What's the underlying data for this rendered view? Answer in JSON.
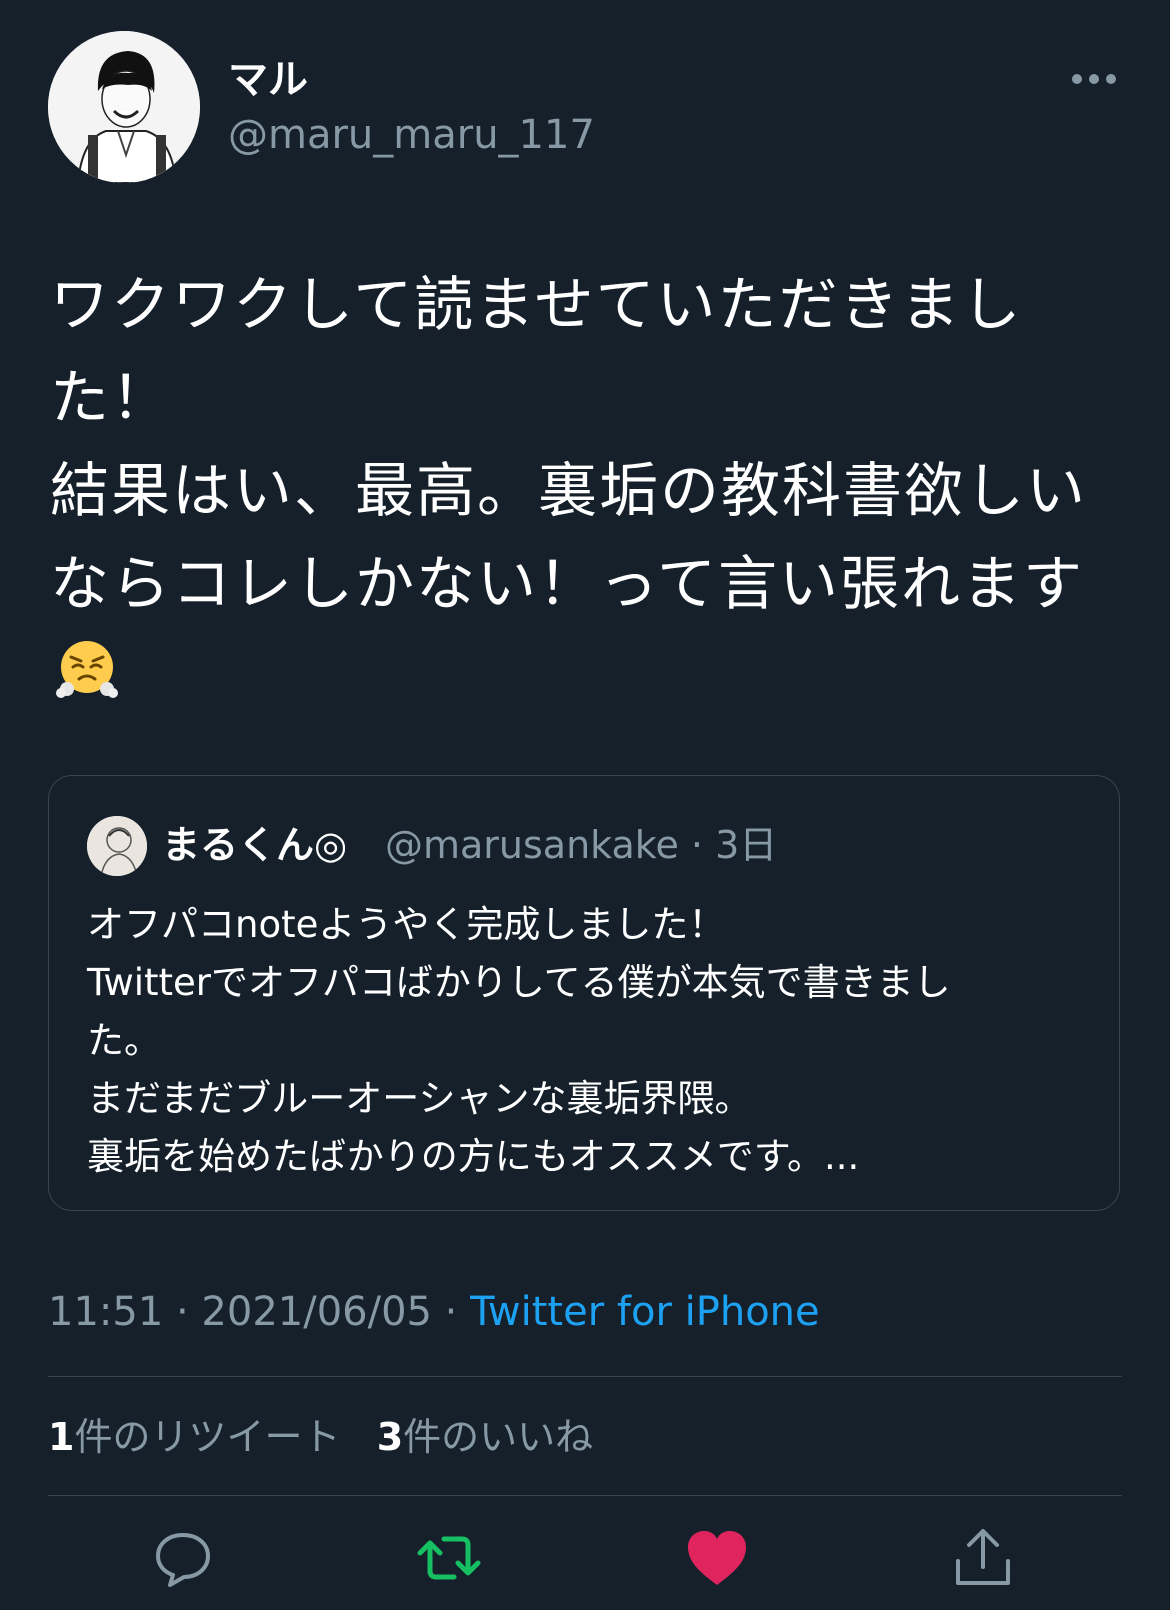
{
  "tweet": {
    "display_name": "マル",
    "handle": "@maru_maru_117",
    "text": "ワクワクして読ませていただきまし\nた！\n結果はい、最高。裏垢の教科書欲しい\nならコレしかない！って言い張れます",
    "emoji": "face-with-steam-from-nose"
  },
  "quote": {
    "display_name": "まるくん◎",
    "handle_time": "@marusankake · 3日",
    "text": "オフパコnoteようやく完成しました！\nTwitterでオフパコばかりしてる僕が本気で書きまし\nた。\nまだまだブルーオーシャンな裏垢界隈。\n裏垢を始めたばかりの方にもオススメです。..."
  },
  "meta": {
    "time_date": "11:51 · 2021/06/05 · ",
    "source": "Twitter for iPhone"
  },
  "stats": {
    "retweet_count": "1",
    "retweet_label": "件のリツイート",
    "like_count": "3",
    "like_label": "件のいいね"
  },
  "colors": {
    "background": "#15202b",
    "secondary_text": "#8899a6",
    "link": "#1da1f2",
    "retweet_active": "#17bf63",
    "like_active": "#e0245e",
    "divider": "#38444d"
  }
}
